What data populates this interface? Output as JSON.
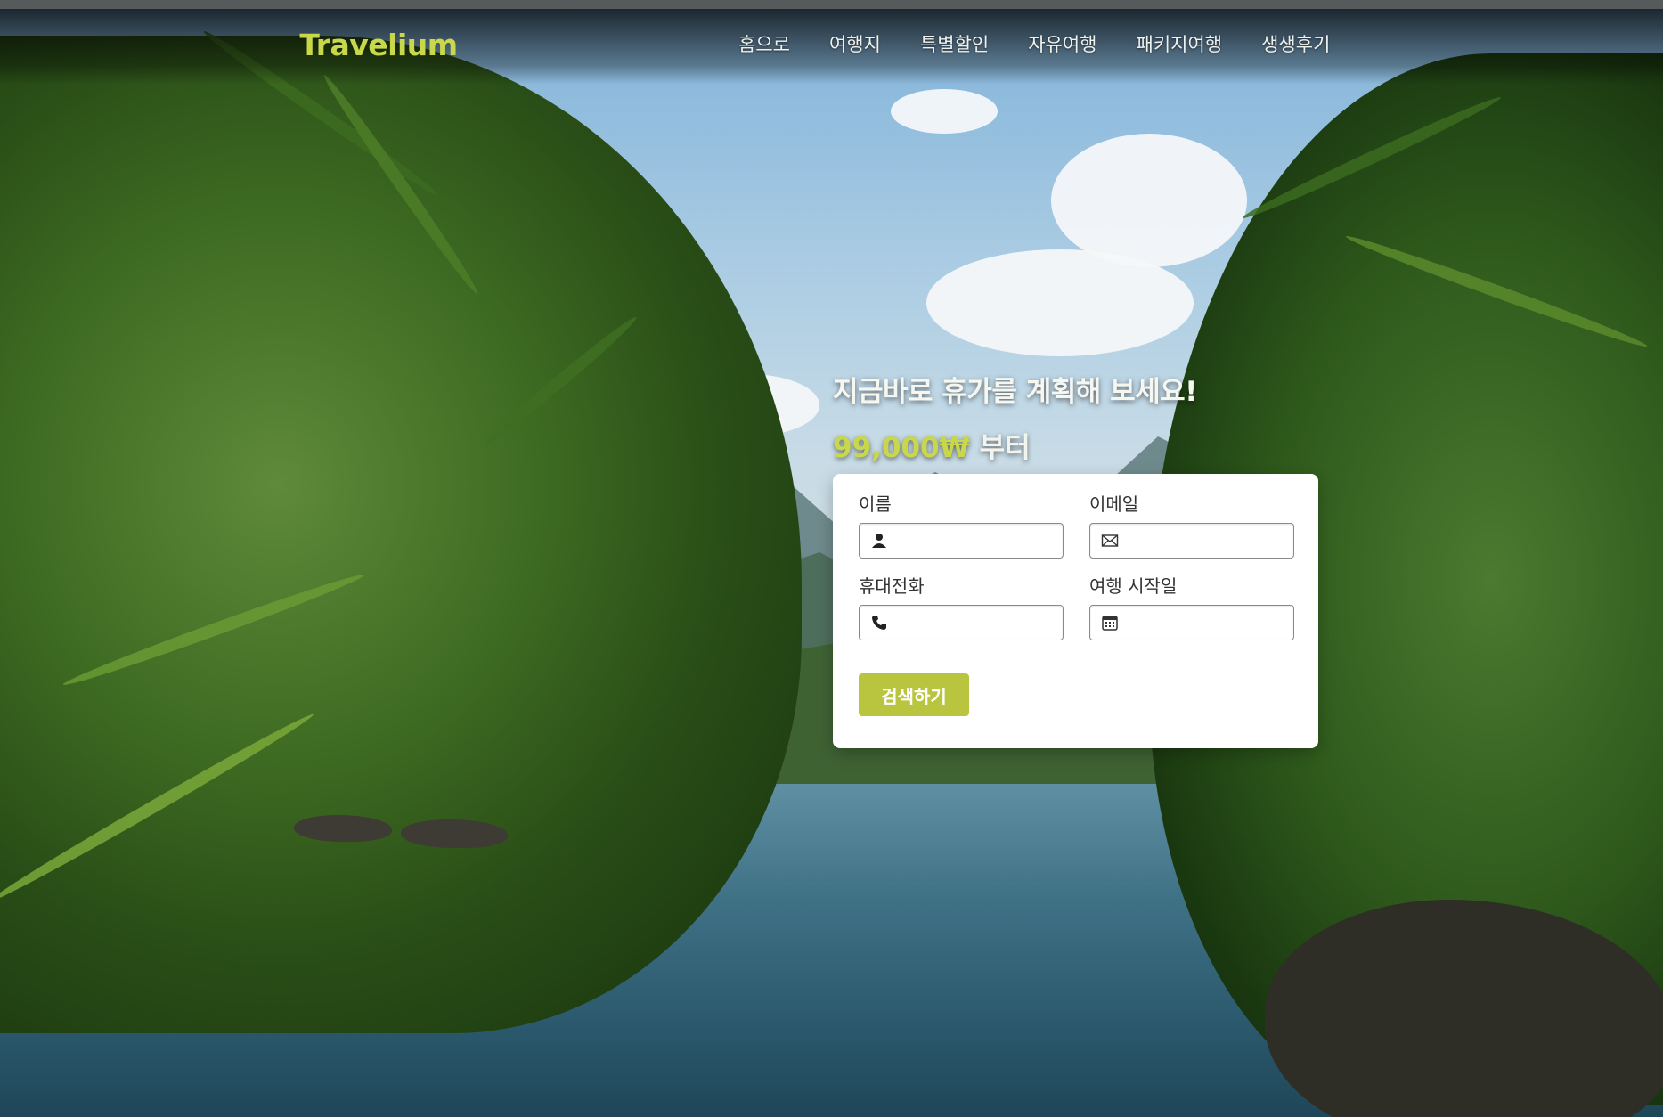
{
  "brand": {
    "logo_text": "Travelium",
    "accent": "#c8d84a"
  },
  "nav": {
    "items": [
      {
        "label": "홈으로"
      },
      {
        "label": "여행지"
      },
      {
        "label": "특별할인"
      },
      {
        "label": "자유여행"
      },
      {
        "label": "패키지여행"
      },
      {
        "label": "생생후기"
      }
    ]
  },
  "hero": {
    "title": "지금바로 휴가를 계획해 보세요!",
    "price": "99,000₩",
    "price_suffix": " 부터"
  },
  "form": {
    "name": {
      "label": "이름",
      "value": "",
      "icon": "user-icon"
    },
    "email": {
      "label": "이메일",
      "value": "",
      "icon": "envelope-icon"
    },
    "phone": {
      "label": "휴대전화",
      "value": "",
      "icon": "phone-icon"
    },
    "start_date": {
      "label": "여행 시작일",
      "value": "",
      "icon": "calendar-icon"
    },
    "submit_label": "검색하기",
    "button_color": "#b9c53f"
  }
}
